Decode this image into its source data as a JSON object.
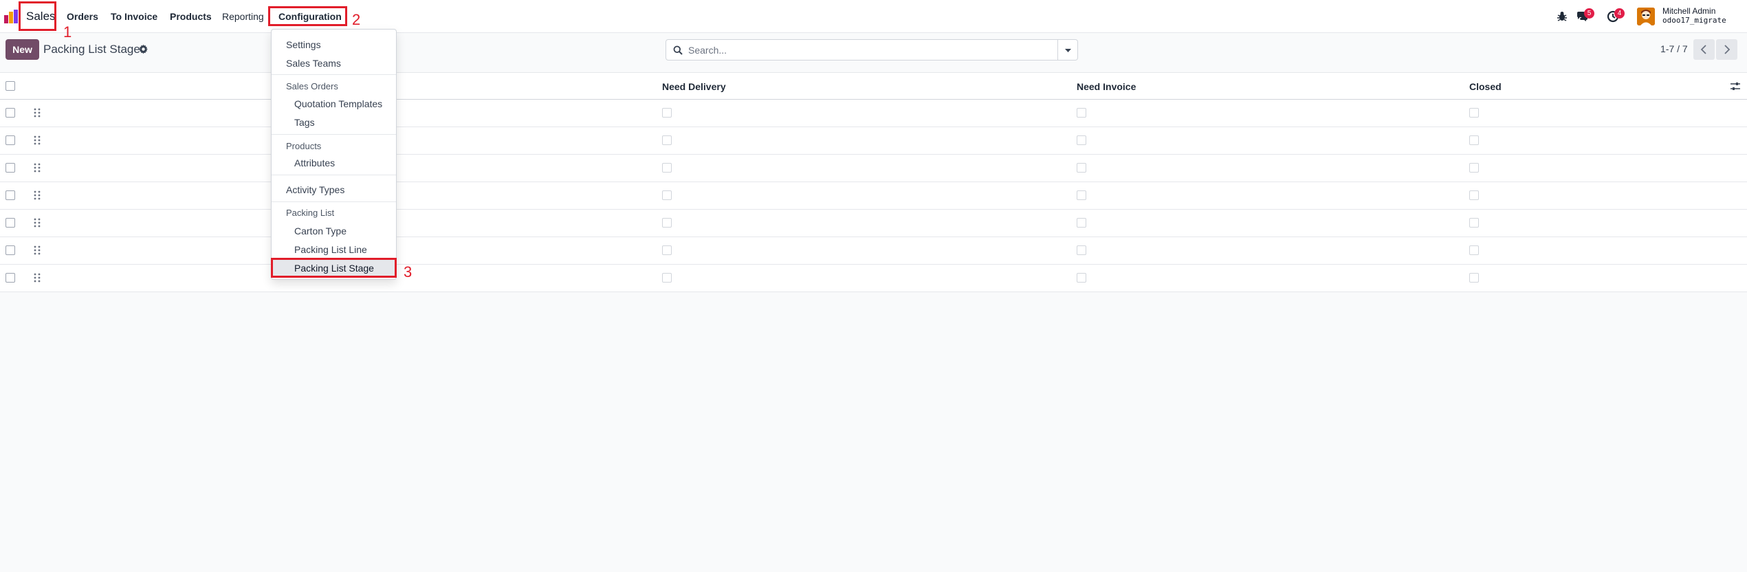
{
  "navbar": {
    "app_name": "Sales",
    "menu": [
      "Orders",
      "To Invoice",
      "Products",
      "Reporting",
      "Configuration"
    ],
    "messages_count": "5",
    "activities_count": "4",
    "user_name": "Mitchell Admin",
    "database": "odoo17_migrate"
  },
  "control_panel": {
    "new_label": "New",
    "title": "Packing List Stage",
    "search_placeholder": "Search...",
    "pager": "1-7 / 7"
  },
  "list": {
    "columns": [
      "Need Delivery",
      "Need Invoice",
      "Closed"
    ],
    "row_count": 7
  },
  "dropdown": {
    "settings": "Settings",
    "sales_teams": "Sales Teams",
    "sales_orders_header": "Sales Orders",
    "quotation_templates": "Quotation Templates",
    "tags": "Tags",
    "products_header": "Products",
    "attributes": "Attributes",
    "activity_types": "Activity Types",
    "packing_list_header": "Packing List",
    "carton_type": "Carton Type",
    "packing_list_line": "Packing List Line",
    "packing_list_stage": "Packing List Stage"
  },
  "annotations": [
    "1",
    "2",
    "3"
  ],
  "colors": {
    "brand": "#714b67",
    "annotation": "#e11d2a",
    "badge": "#e11d48"
  }
}
